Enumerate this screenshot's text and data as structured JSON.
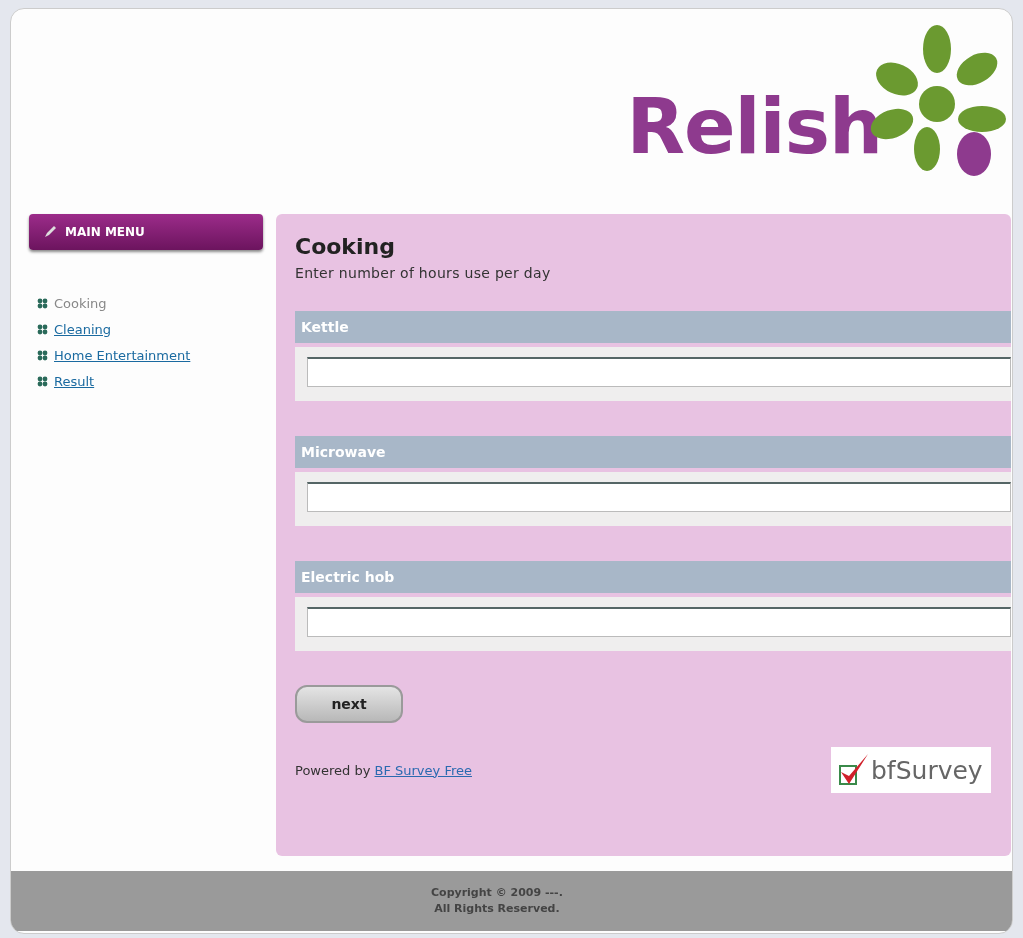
{
  "logo": {
    "text": "Relish"
  },
  "menu": {
    "title": "MAIN MENU",
    "items": [
      {
        "label": "Cooking",
        "selected": true
      },
      {
        "label": "Cleaning",
        "selected": false
      },
      {
        "label": "Home Entertainment",
        "selected": false
      },
      {
        "label": "Result",
        "selected": false
      }
    ]
  },
  "survey": {
    "title": "Cooking",
    "instruction": "Enter number of hours use per day",
    "questions": [
      {
        "label": "Kettle"
      },
      {
        "label": "Microwave"
      },
      {
        "label": "Electric hob"
      }
    ],
    "next_button": "next",
    "powered_by": {
      "text": "Powered by",
      "link": "BF Survey Free"
    },
    "badge": "bfSurvey"
  },
  "footer": {
    "lines": [
      "Copyright © 2009 ---.",
      "All Rights Reserved."
    ]
  }
}
